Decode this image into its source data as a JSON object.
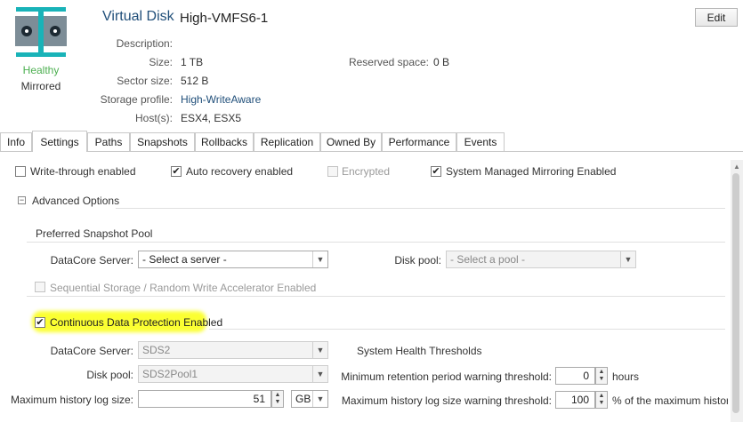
{
  "header": {
    "type": "Virtual Disk",
    "name": "High-VMFS6-1",
    "edit_label": "Edit",
    "status": "Healthy",
    "mirror_state": "Mirrored",
    "colors": {
      "accent": "#1f4e79",
      "healthy": "#4caf50",
      "icon_teal": "#19b3b8"
    }
  },
  "properties": {
    "description_label": "Description:",
    "description_value": "",
    "size_label": "Size:",
    "size_value": "1 TB",
    "sector_label": "Sector size:",
    "sector_value": "512 B",
    "profile_label": "Storage profile:",
    "profile_value": "High-WriteAware",
    "hosts_label": "Host(s):",
    "hosts_value": "ESX4, ESX5",
    "reserved_label": "Reserved space:",
    "reserved_value": "0 B"
  },
  "tabs": [
    "Info",
    "Settings",
    "Paths",
    "Snapshots",
    "Rollbacks",
    "Replication",
    "Owned By",
    "Performance",
    "Events"
  ],
  "settings": {
    "write_through": {
      "label": "Write-through enabled",
      "checked": false
    },
    "auto_recovery": {
      "label": "Auto recovery enabled",
      "checked": true
    },
    "encrypted": {
      "label": "Encrypted",
      "checked": false
    },
    "system_mirroring": {
      "label": "System Managed Mirroring Enabled",
      "checked": true
    },
    "advanced_label": "Advanced Options",
    "snapshot_pool_heading": "Preferred Snapshot Pool",
    "snap_server_label": "DataCore Server:",
    "snap_server_value": "- Select a server -",
    "snap_pool_label": "Disk pool:",
    "snap_pool_value": "- Select a pool -",
    "sequential": {
      "label": "Sequential Storage / Random Write Accelerator Enabled",
      "checked": false
    },
    "cdp": {
      "label": "Continuous Data Protection Enabled",
      "checked": true
    },
    "cdp_server_label": "DataCore Server:",
    "cdp_server_value": "SDS2",
    "cdp_pool_label": "Disk pool:",
    "cdp_pool_value": "SDS2Pool1",
    "history_label": "Maximum history log size:",
    "history_value": "51",
    "history_unit": "GB",
    "health_heading": "System Health Thresholds",
    "retention_label": "Minimum retention period warning threshold:",
    "retention_value": "0",
    "retention_unit": "hours",
    "history_warn_label": "Maximum history log size warning threshold:",
    "history_warn_value": "100",
    "history_warn_unit": "% of the maximum history l"
  }
}
